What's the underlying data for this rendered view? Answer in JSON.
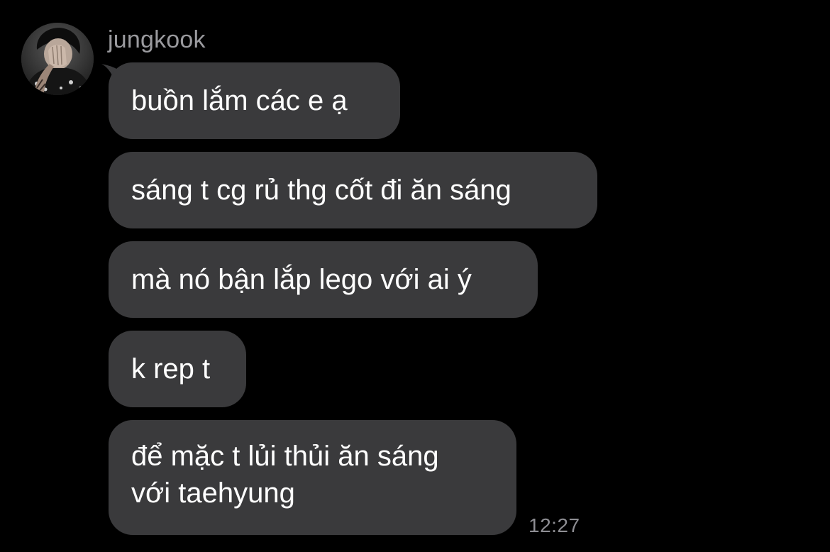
{
  "conversation": {
    "sender": "jungkook",
    "avatar": "profile-photo",
    "messages": [
      "buồn lắm các e ạ",
      "sáng t cg rủ thg cốt đi ăn sáng",
      "mà nó bận lắp lego với ai ý",
      "k rep t",
      "để mặc t lủi thủi ăn sáng\nvới taehyung"
    ],
    "timestamp": "12:27"
  },
  "colors": {
    "background": "#000000",
    "bubble": "#3a3a3c",
    "message_text": "#ffffff",
    "sender_name": "#9a9a9e",
    "timestamp": "#8e8e93"
  }
}
